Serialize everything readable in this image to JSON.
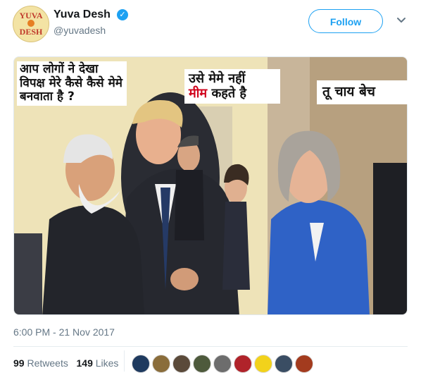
{
  "tweet": {
    "author": {
      "name": "Yuva Desh",
      "handle": "@yuvadesh",
      "avatar_line1": "YUVA",
      "avatar_line2": "DESH",
      "verified_icon": "verified-badge-icon"
    },
    "follow_label": "Follow",
    "menu_icon": "chevron-down-icon",
    "meme": {
      "bubble_left": "आप लोगों ने देखा विपक्ष मेरे कैसे कैसे मेमे बनवाता है ?",
      "bubble_middle_line1": "उसे मेमे नहीं",
      "bubble_middle_red": "मीम",
      "bubble_middle_line2_rest": "कहते है",
      "bubble_right": "तू चाय बेच"
    },
    "timestamp": "6:00 PM - 21 Nov 2017",
    "retweets_count": "99",
    "retweets_label": "Retweets",
    "likes_count": "149",
    "likes_label": "Likes",
    "likers": [
      {
        "name": "liker-avatar-1",
        "color": "#1f3a5f"
      },
      {
        "name": "liker-avatar-2",
        "color": "#8a6d3b"
      },
      {
        "name": "liker-avatar-3",
        "color": "#5b4a3a"
      },
      {
        "name": "liker-avatar-4",
        "color": "#4e5a3c"
      },
      {
        "name": "liker-avatar-5",
        "color": "#6d6d6d"
      },
      {
        "name": "liker-avatar-6",
        "color": "#b0232a"
      },
      {
        "name": "liker-avatar-7",
        "color": "#f2d21b"
      },
      {
        "name": "liker-avatar-8",
        "color": "#3a4d63"
      },
      {
        "name": "liker-avatar-9",
        "color": "#a33b1e"
      }
    ]
  },
  "colors": {
    "accent": "#1da1f2",
    "secondary_text": "#657786",
    "meme_highlight": "#d0021b"
  }
}
